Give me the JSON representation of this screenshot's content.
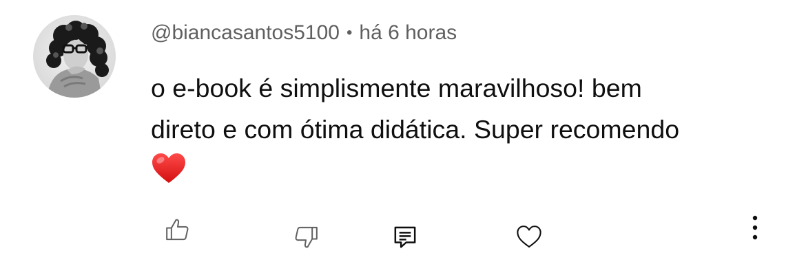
{
  "comment": {
    "author": "@biancasantos5100",
    "separator": "•",
    "time": "há 6 horas",
    "text_line1": "o e-book é simplismente maravilhoso! bem",
    "text_line2": "direto e com ótima didática. Super recomendo",
    "emoji": "red-heart"
  },
  "actions": {
    "like_icon": "thumbs-up-icon",
    "dislike_icon": "thumbs-down-icon",
    "reply_icon": "reply-comment-icon",
    "heart_icon": "heart-outline-icon",
    "more_icon": "more-vertical-icon"
  }
}
